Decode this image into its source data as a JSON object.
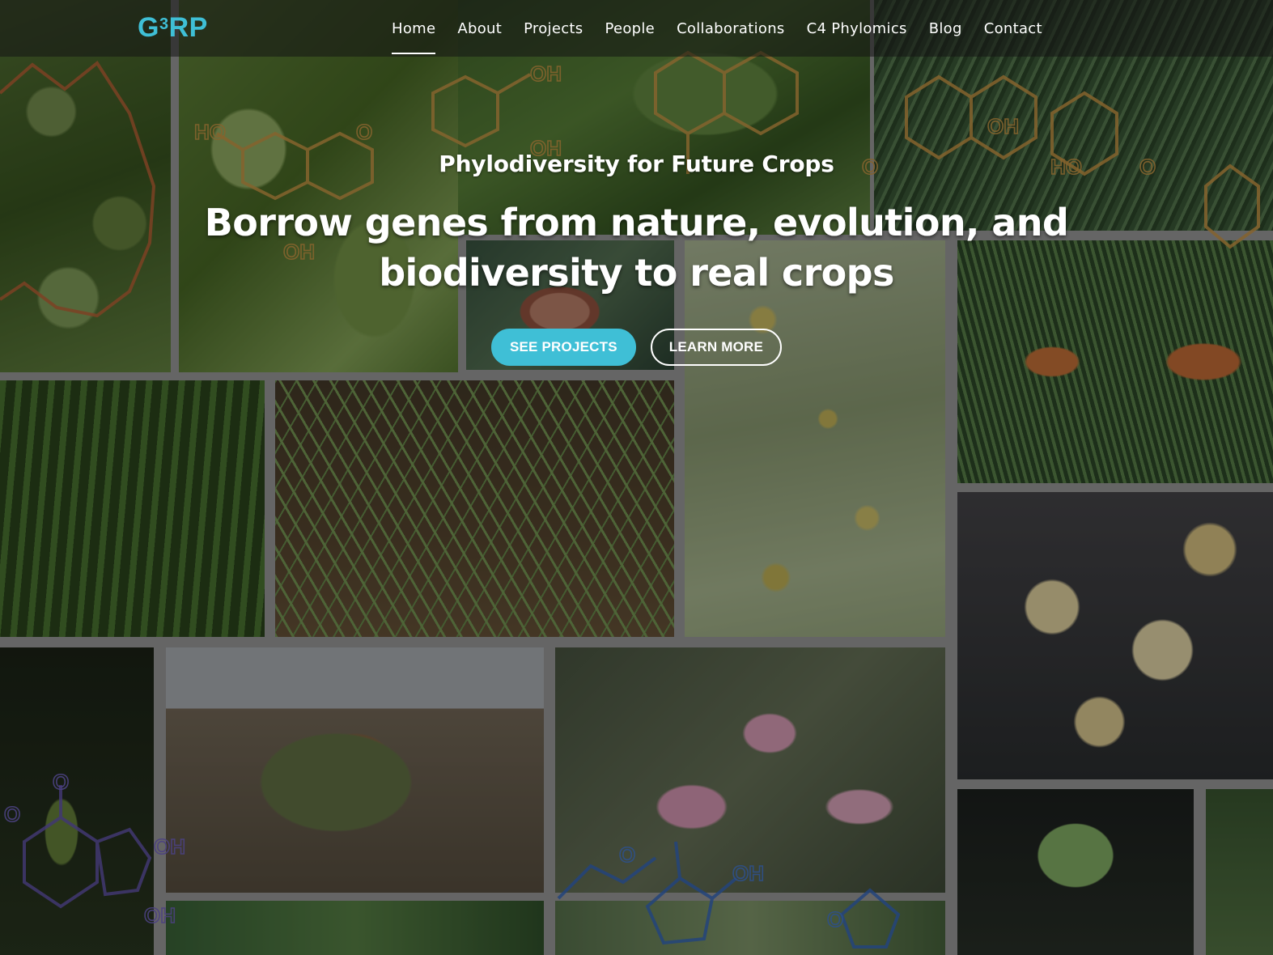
{
  "site": {
    "logo_main": "G",
    "logo_sup": "3",
    "logo_tail": "RP",
    "accent_color": "#3fbfd6"
  },
  "nav": {
    "items": [
      {
        "label": "Home",
        "active": true
      },
      {
        "label": "About"
      },
      {
        "label": "Projects"
      },
      {
        "label": "People"
      },
      {
        "label": "Collaborations"
      },
      {
        "label": "C4 Phylomics"
      },
      {
        "label": "Blog"
      },
      {
        "label": "Contact"
      }
    ]
  },
  "hero": {
    "subtitle": "Phylodiversity for Future Crops",
    "title": "Borrow genes from nature, evolution, and biodiversity to real crops",
    "primary_button": "SEE PROJECTS",
    "secondary_button": "LEARN MORE"
  },
  "background": {
    "molecule_labels": [
      "HO",
      "O",
      "OH",
      "OH",
      "OH",
      "OH",
      "O",
      "HO",
      "O",
      "O",
      "OH",
      "OH",
      "O",
      "O",
      "OH",
      "O"
    ]
  }
}
